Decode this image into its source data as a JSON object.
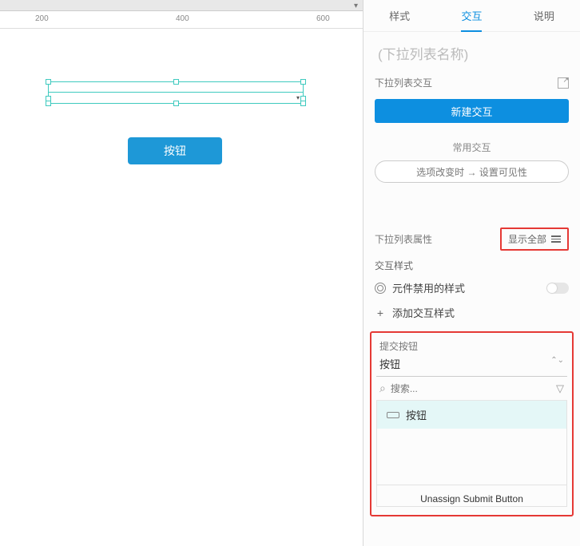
{
  "ruler": {
    "t200": "200",
    "t400": "400",
    "t600": "600"
  },
  "canvas": {
    "button_label": "按钮"
  },
  "tabs": {
    "style": "样式",
    "interact": "交互",
    "notes": "说明"
  },
  "widget_name_placeholder": "(下拉列表名称)",
  "ix": {
    "section_label": "下拉列表交互",
    "new_button": "新建交互",
    "common_title": "常用交互",
    "preset": "选项改变时 → 设置可见性"
  },
  "attrs": {
    "section_label": "下拉列表属性",
    "show_all": "显示全部",
    "ix_style_label": "交互样式",
    "disabled_style": "元件禁用的样式",
    "add_style": "添加交互样式"
  },
  "submit": {
    "label": "提交按钮",
    "current": "按钮",
    "search_placeholder": "搜索...",
    "option1": "按钮",
    "unassign": "Unassign Submit Button"
  }
}
